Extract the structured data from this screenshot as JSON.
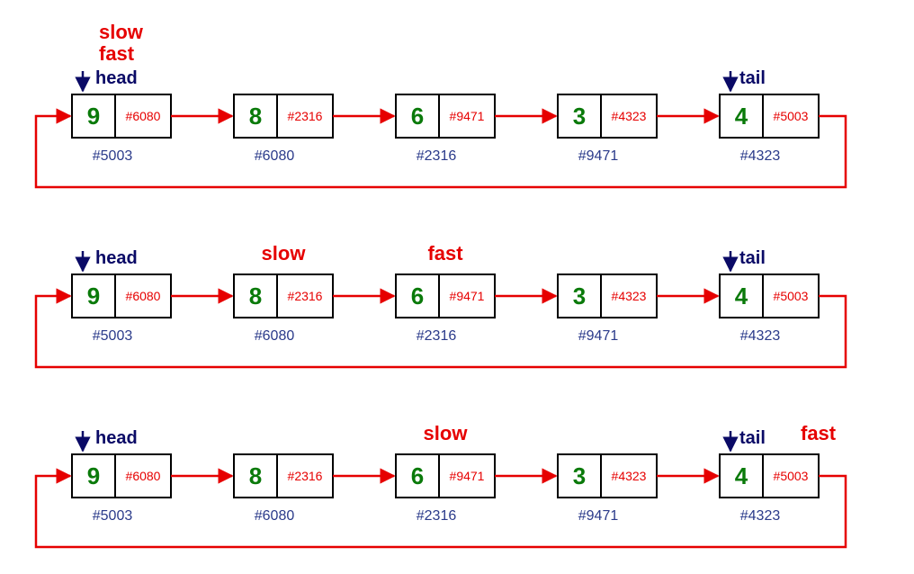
{
  "labels": {
    "slow": "slow",
    "fast": "fast",
    "head": "head",
    "tail": "tail"
  },
  "rows": [
    {
      "head_node": 0,
      "tail_node": 4,
      "slow_node": 0,
      "fast_node": 0,
      "nodes": [
        {
          "value": "9",
          "ptr": "#6080",
          "addr": "#5003"
        },
        {
          "value": "8",
          "ptr": "#2316",
          "addr": "#6080"
        },
        {
          "value": "6",
          "ptr": "#9471",
          "addr": "#2316"
        },
        {
          "value": "3",
          "ptr": "#4323",
          "addr": "#9471"
        },
        {
          "value": "4",
          "ptr": "#5003",
          "addr": "#4323"
        }
      ]
    },
    {
      "head_node": 0,
      "tail_node": 4,
      "slow_node": 1,
      "fast_node": 2,
      "nodes": [
        {
          "value": "9",
          "ptr": "#6080",
          "addr": "#5003"
        },
        {
          "value": "8",
          "ptr": "#2316",
          "addr": "#6080"
        },
        {
          "value": "6",
          "ptr": "#9471",
          "addr": "#2316"
        },
        {
          "value": "3",
          "ptr": "#4323",
          "addr": "#9471"
        },
        {
          "value": "4",
          "ptr": "#5003",
          "addr": "#4323"
        }
      ]
    },
    {
      "head_node": 0,
      "tail_node": 4,
      "slow_node": 2,
      "fast_node": 4,
      "nodes": [
        {
          "value": "9",
          "ptr": "#6080",
          "addr": "#5003"
        },
        {
          "value": "8",
          "ptr": "#2316",
          "addr": "#6080"
        },
        {
          "value": "6",
          "ptr": "#9471",
          "addr": "#2316"
        },
        {
          "value": "3",
          "ptr": "#4323",
          "addr": "#9471"
        },
        {
          "value": "4",
          "ptr": "#5003",
          "addr": "#4323"
        }
      ]
    }
  ],
  "chart_data": {
    "type": "diagram",
    "description": "Circular singly linked list cycle detection using slow/fast (Floyd's tortoise and hare) pointers. Three snapshots of the same 5-node circular list at successive steps.",
    "nodes": [
      {
        "index": 0,
        "value": 9,
        "address": "#5003",
        "next": "#6080"
      },
      {
        "index": 1,
        "value": 8,
        "address": "#6080",
        "next": "#2316"
      },
      {
        "index": 2,
        "value": 6,
        "address": "#2316",
        "next": "#9471"
      },
      {
        "index": 3,
        "value": 3,
        "address": "#9471",
        "next": "#4323"
      },
      {
        "index": 4,
        "value": 4,
        "address": "#4323",
        "next": "#5003"
      }
    ],
    "head_index": 0,
    "tail_index": 4,
    "steps": [
      {
        "step": 0,
        "slow_index": 0,
        "fast_index": 0
      },
      {
        "step": 1,
        "slow_index": 1,
        "fast_index": 2
      },
      {
        "step": 2,
        "slow_index": 2,
        "fast_index": 4
      }
    ]
  }
}
